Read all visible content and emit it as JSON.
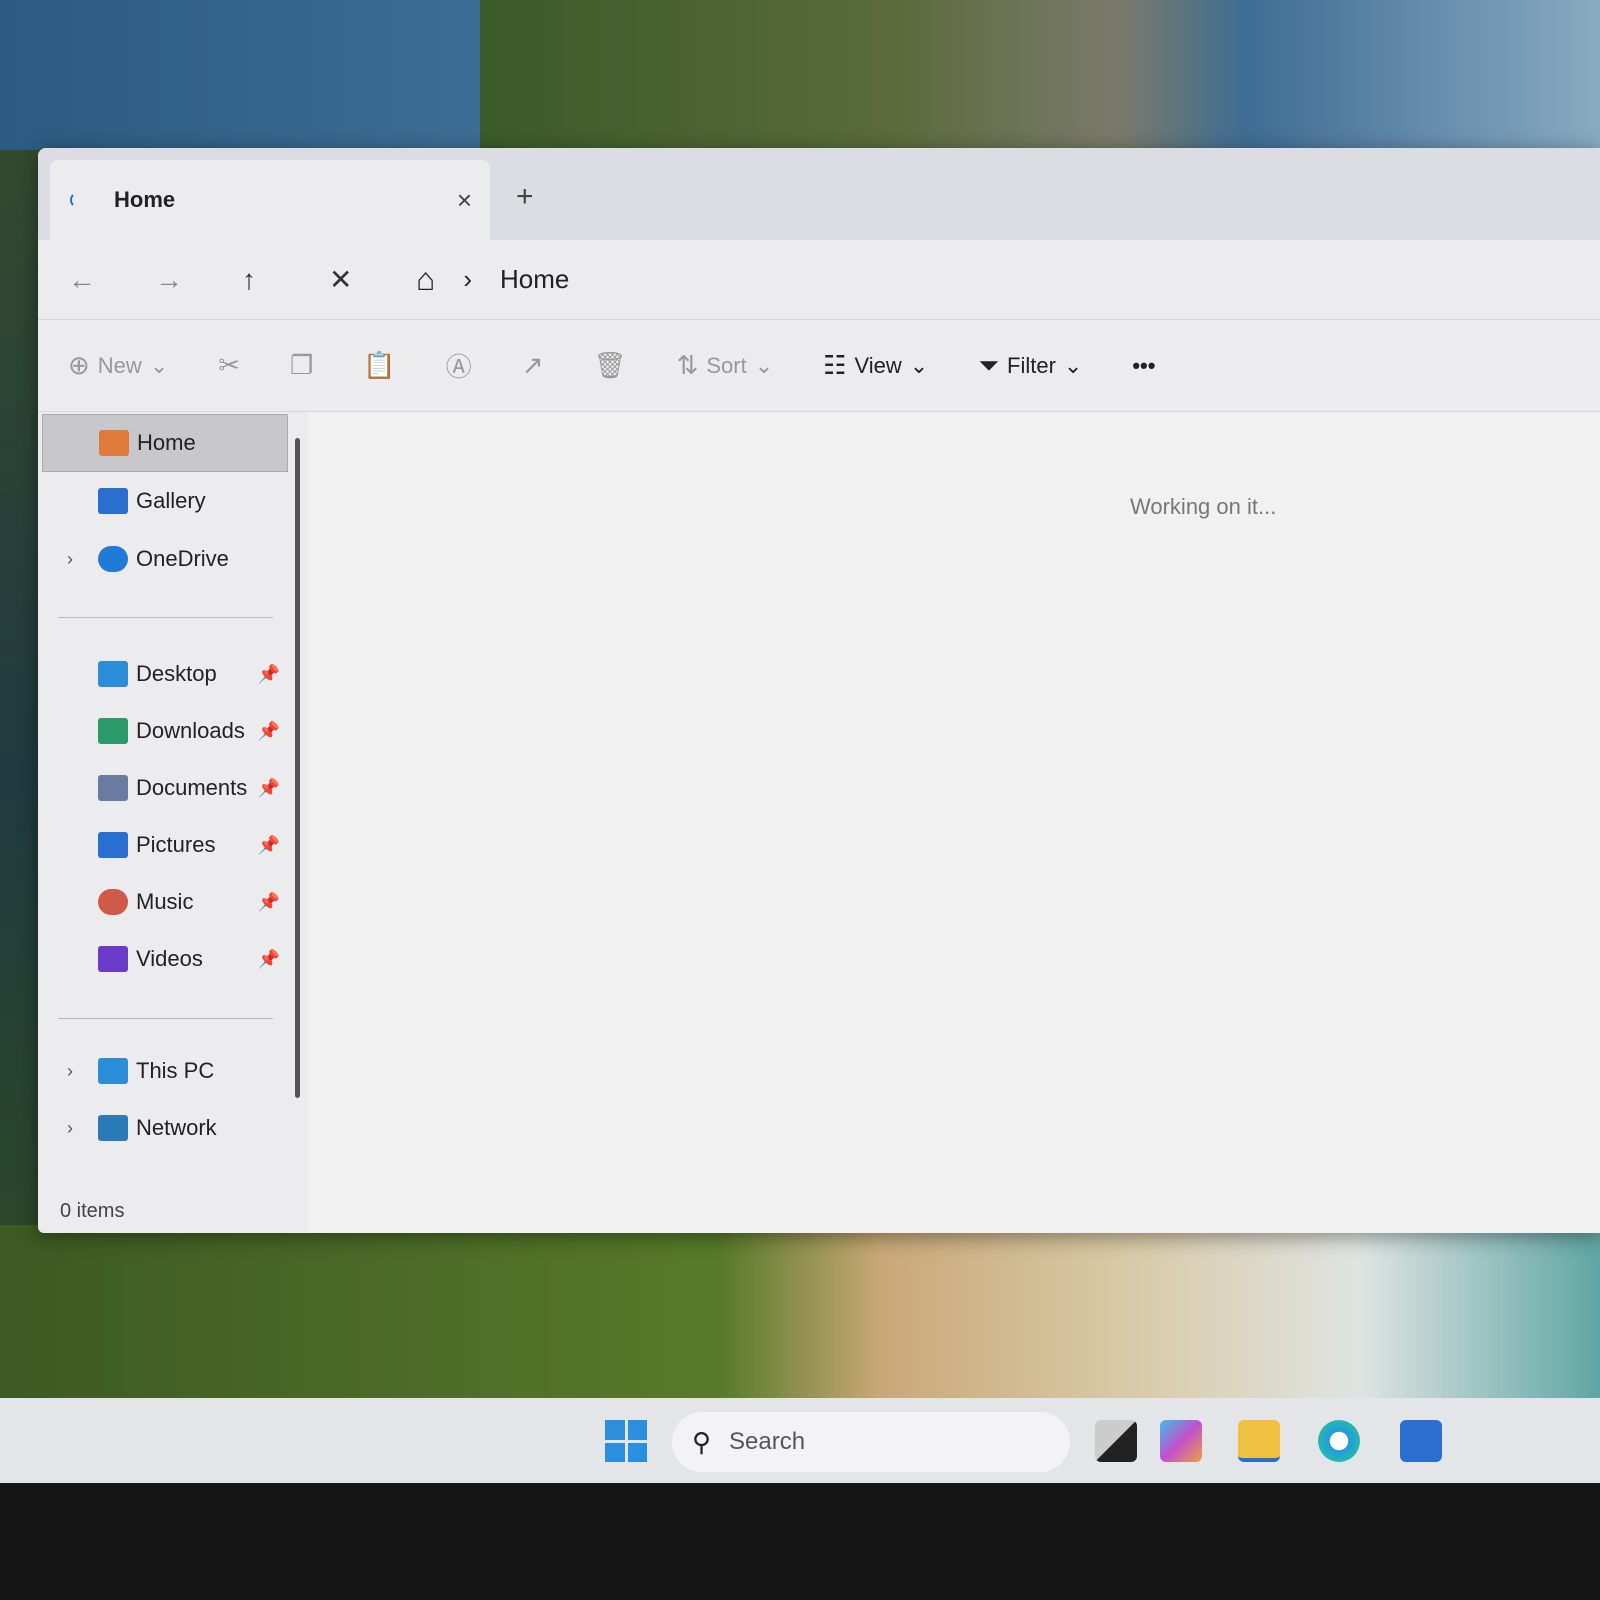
{
  "tab": {
    "title": "Home",
    "close": "×",
    "new": "+"
  },
  "nav": {
    "back": "←",
    "forward": "→",
    "up": "↑",
    "stop": "✕",
    "home_icon": "⌂",
    "sep": "›",
    "location": "Home"
  },
  "toolbar": {
    "new": "New",
    "sort": "Sort",
    "view": "View",
    "filter": "Filter",
    "more": "•••",
    "chev": "⌄"
  },
  "sidebar": {
    "items": [
      {
        "label": "Home",
        "icon": "home-icon",
        "color": "#e07a3a"
      },
      {
        "label": "Gallery",
        "icon": "gallery-icon",
        "color": "#2a6fd0"
      },
      {
        "label": "OneDrive",
        "icon": "onedrive-icon",
        "color": "#1f7ad8"
      },
      {
        "label": "Desktop",
        "icon": "desktop-icon",
        "color": "#2a8fd8"
      },
      {
        "label": "Downloads",
        "icon": "download-icon",
        "color": "#2a9a6a"
      },
      {
        "label": "Documents",
        "icon": "documents-icon",
        "color": "#6a7aa0"
      },
      {
        "label": "Pictures",
        "icon": "pictures-icon",
        "color": "#2a6fd0"
      },
      {
        "label": "Music",
        "icon": "music-icon",
        "color": "#d05a4a"
      },
      {
        "label": "Videos",
        "icon": "videos-icon",
        "color": "#6a3ac8"
      },
      {
        "label": "This PC",
        "icon": "this-pc-icon",
        "color": "#2a8fd8"
      },
      {
        "label": "Network",
        "icon": "network-icon",
        "color": "#2a7ab8"
      }
    ],
    "pin": "📌",
    "chev": "›"
  },
  "content": {
    "message": "Working on it..."
  },
  "status": {
    "items": "0 items"
  },
  "taskbar": {
    "search": "Search"
  }
}
